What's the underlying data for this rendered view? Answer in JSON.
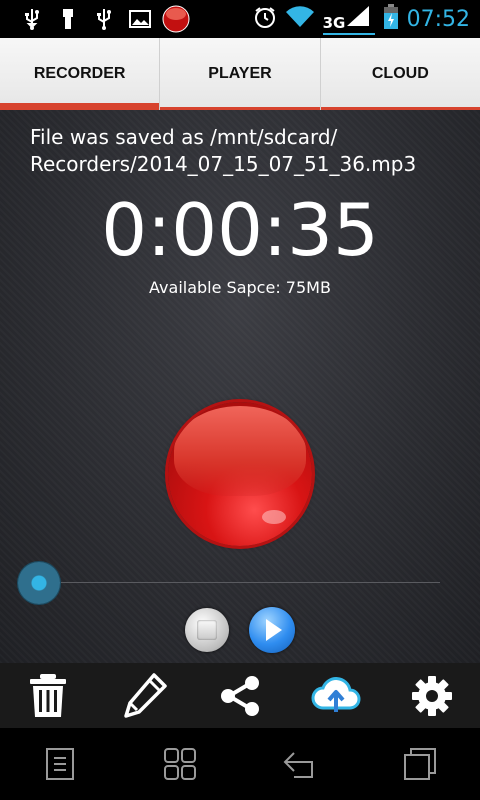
{
  "status_bar": {
    "network": "3G",
    "time": "07:52",
    "accent": "#33b5e5",
    "icons": [
      "usb-icon",
      "usb-stick-icon",
      "usb-icon",
      "image-icon",
      "record-app-icon",
      "alarm-icon",
      "wifi-icon",
      "signal-icon",
      "battery-charging-icon"
    ]
  },
  "tabs": [
    {
      "label": "RECORDER",
      "active": true
    },
    {
      "label": "PLAYER",
      "active": false
    },
    {
      "label": "CLOUD",
      "active": false
    }
  ],
  "main": {
    "message": "File was saved as /mnt/sdcard/ Recorders/2014_07_15_07_51_36.mp3",
    "timer": "0:00:35",
    "available_space": "Available Sapce: 75MB",
    "progress": 0.0
  },
  "toolbar": {
    "items": [
      "trash-icon",
      "pencil-icon",
      "share-icon",
      "cloud-upload-icon",
      "gear-icon"
    ]
  },
  "colors": {
    "tab_indicator": "#d7432e",
    "record": "#d81414",
    "slider": "#33b5e5"
  }
}
